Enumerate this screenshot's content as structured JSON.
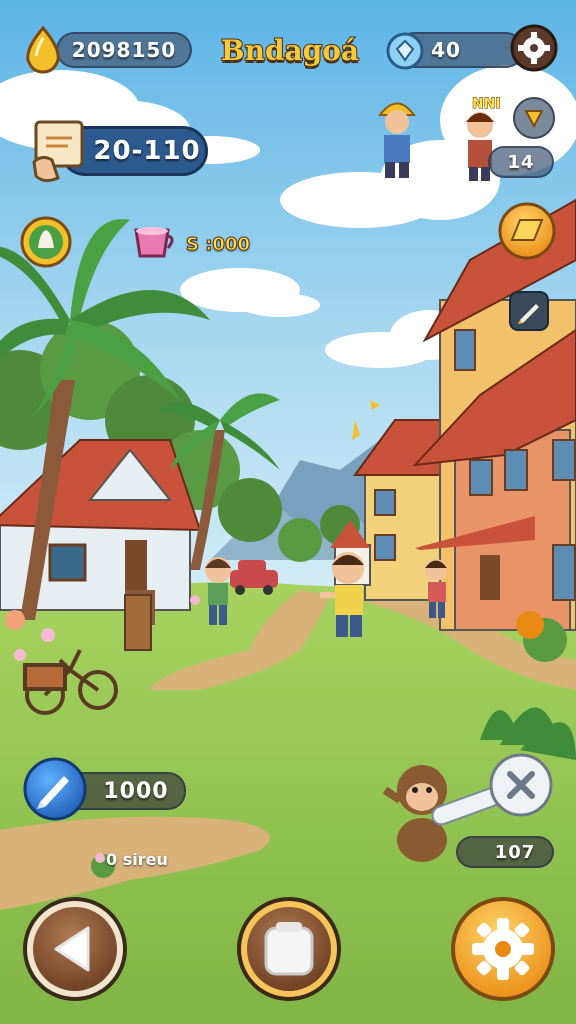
{
  "hud": {
    "gold_value": "2098150",
    "title": "Bndagoá",
    "gems_value": "40",
    "quest_value": "20-110",
    "npc_tag": "NNI",
    "npc_count": "14",
    "cup_reward": "S :000",
    "pen_value": "1000",
    "flower_text": "0 sireu",
    "monkey_count": "107"
  },
  "icons": {
    "gold": "gold-drop-icon",
    "gem": "diamond-icon",
    "settings_top": "gear-icon",
    "quest": "scroll-icon",
    "location": "location-pin-icon",
    "gold_bar": "gold-bar-icon",
    "edit": "pencil-icon",
    "potion": "potion-icon",
    "cup": "cup-icon",
    "pen": "pen-icon",
    "close": "close-icon",
    "back": "back-arrow-icon",
    "inventory": "bag-icon",
    "settings_bottom": "gear-icon"
  },
  "colors": {
    "sky_top": "#5fb6e8",
    "grass": "#8cc152",
    "path": "#d9b27a",
    "accent_gold": "#f3b52b",
    "roof": "#c8533a",
    "button_brown": "#8a5a3a"
  }
}
